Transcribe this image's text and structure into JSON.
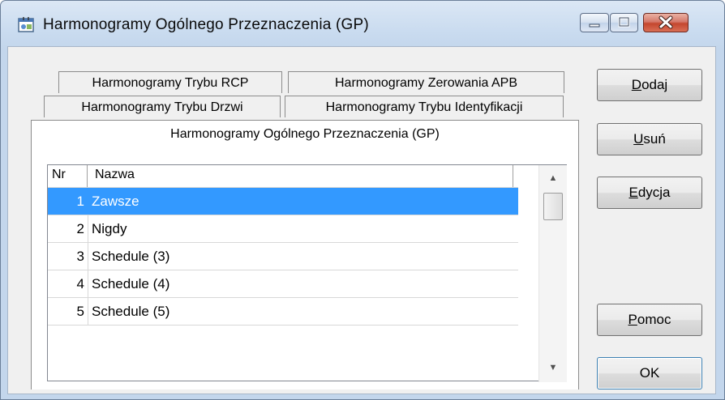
{
  "window": {
    "title": "Harmonogramy Ogólnego Przeznaczenia (GP)"
  },
  "tabs": {
    "row1": [
      "Harmonogramy Trybu RCP",
      "Harmonogramy Zerowania APB"
    ],
    "row2": [
      "Harmonogramy Trybu Drzwi",
      "Harmonogramy Trybu Identyfikacji"
    ],
    "selected": "Harmonogramy Ogólnego Przeznaczenia (GP)"
  },
  "table": {
    "columns": [
      "Nr",
      "Nazwa"
    ],
    "rows": [
      {
        "nr": "1",
        "name": "Zawsze",
        "selected": true
      },
      {
        "nr": "2",
        "name": "Nigdy",
        "selected": false
      },
      {
        "nr": "3",
        "name": "Schedule (3)",
        "selected": false
      },
      {
        "nr": "4",
        "name": "Schedule (4)",
        "selected": false
      },
      {
        "nr": "5",
        "name": "Schedule (5)",
        "selected": false
      }
    ]
  },
  "buttons": {
    "add": {
      "mnemonic": "D",
      "rest": "odaj"
    },
    "delete": {
      "mnemonic": "U",
      "rest": "suń"
    },
    "edit": {
      "mnemonic": "E",
      "rest": "dycja"
    },
    "help": {
      "mnemonic": "P",
      "rest": "omoc"
    },
    "ok": "OK"
  },
  "icons": {
    "app": "schedule-app-icon",
    "minimize": "minimize-icon",
    "maximize": "maximize-icon",
    "close": "close-icon",
    "scroll_up": "scroll-up-arrow-icon",
    "scroll_down": "scroll-down-arrow-icon"
  },
  "colors": {
    "selection": "#3399ff",
    "close_button": "#c4462f"
  }
}
